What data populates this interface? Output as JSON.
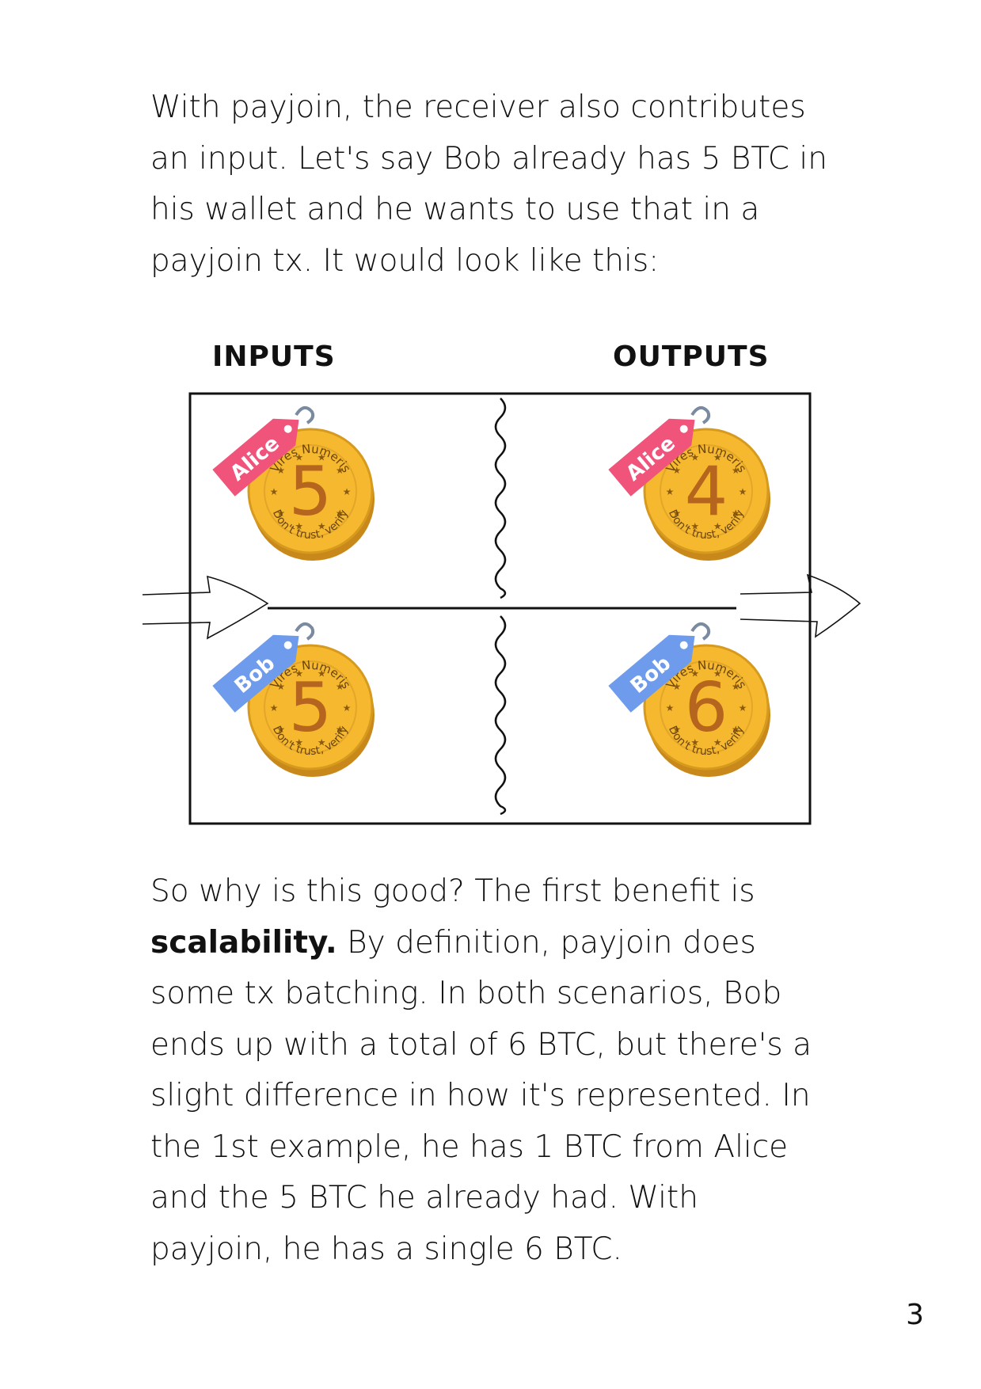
{
  "intro_lines": [
    "With payjoin, the receiver also contributes",
    "an input. Let's say Bob already has 5 BTC in",
    "his wallet and he wants to use that in a",
    "payjoin tx. It would look like this:"
  ],
  "diagram": {
    "inputs_label": "INPUTS",
    "outputs_label": "OUTPUTS",
    "coin_text_top": "Vires Numeris",
    "coin_text_bottom": "Don't trust, verify",
    "coins": [
      {
        "tag": "Alice",
        "value": "5",
        "tag_color": "#f0547a"
      },
      {
        "tag": "Alice",
        "value": "4",
        "tag_color": "#f0547a"
      },
      {
        "tag": "Bob",
        "value": "5",
        "tag_color": "#6f9bec"
      },
      {
        "tag": "Bob",
        "value": "6",
        "tag_color": "#6f9bec"
      }
    ],
    "coin_color": "#f5b82e"
  },
  "body_lines": {
    "l1": "So why is this good? The first benefit is",
    "l2_bold": "scalability.",
    "l2_rest": " By definition, payjoin does",
    "l3": "some tx batching. In both scenarios, Bob",
    "l4": "ends up with a total of 6 BTC, but there's a",
    "l5": "slight difference in how it's represented. In",
    "l6": "the 1st example, he has 1 BTC from Alice",
    "l7": "and the 5 BTC he already had. With",
    "l8": "payjoin, he has a single 6 BTC."
  },
  "page_number": "3"
}
